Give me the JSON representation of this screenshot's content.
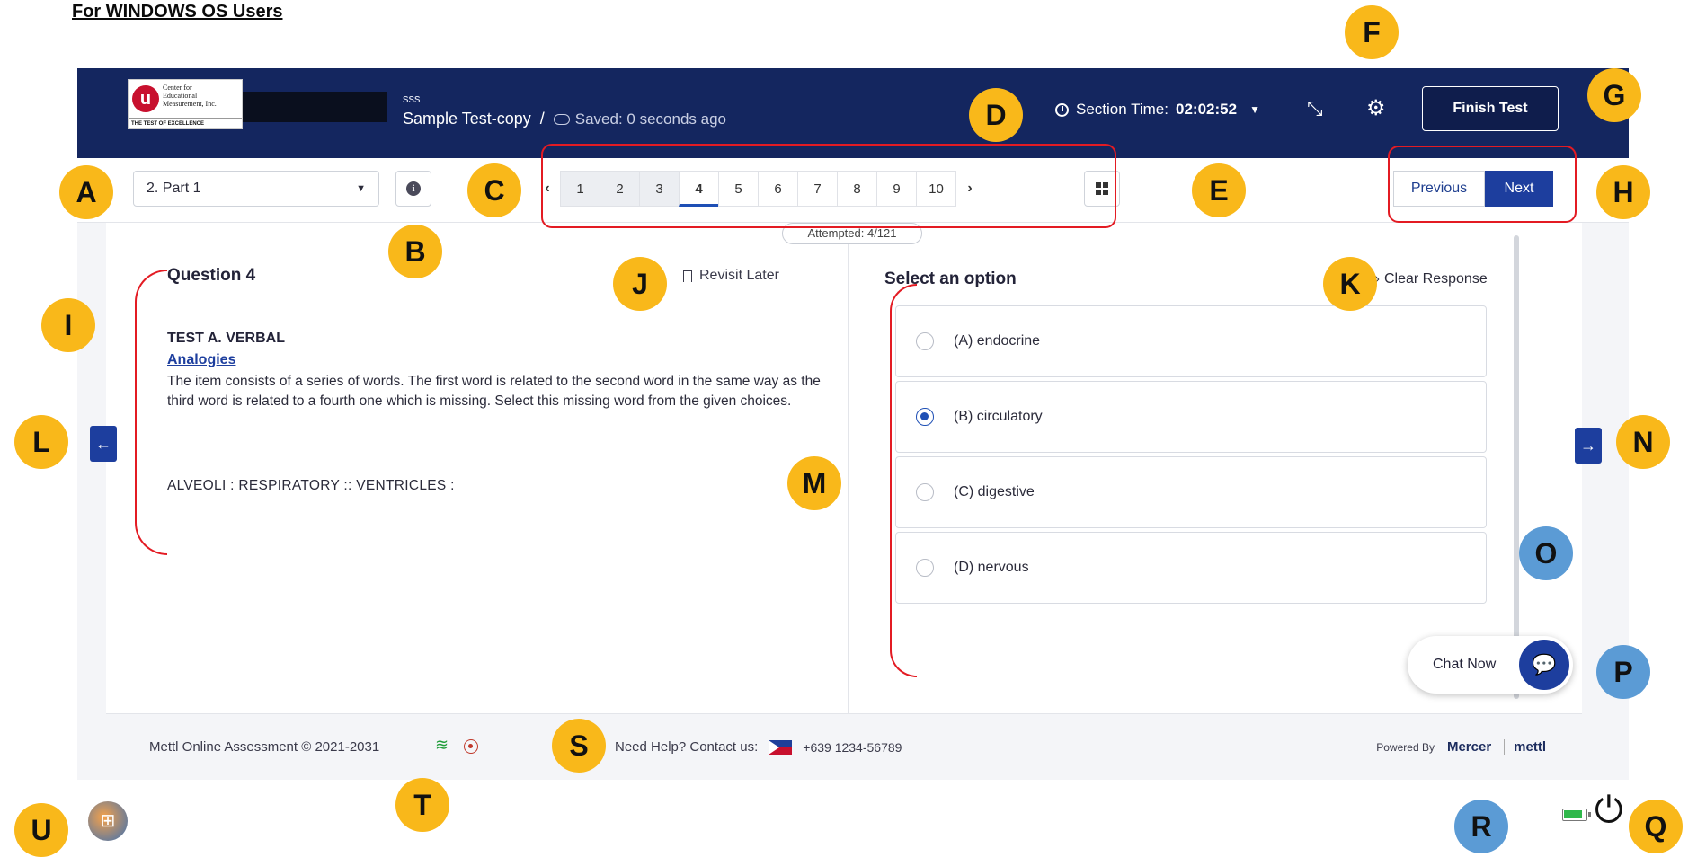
{
  "doc": {
    "heading": "For WINDOWS OS Users"
  },
  "header": {
    "logo_lines": [
      "Center for",
      "Educational",
      "Measurement, Inc."
    ],
    "logo_tagline": "THE TEST OF EXCELLENCE",
    "logo_letter": "u",
    "crumb_top": "sss",
    "test_name": "Sample Test-copy",
    "separator": "/",
    "saved_status": "Saved: 0 seconds ago",
    "section_time_label": "Section Time:",
    "section_time_value": "02:02:52",
    "finish_label": "Finish Test"
  },
  "toolbar": {
    "section_value": "2. Part 1",
    "question_numbers": [
      "1",
      "2",
      "3",
      "4",
      "5",
      "6",
      "7",
      "8",
      "9",
      "10"
    ],
    "current_question": "4",
    "prev_label": "Previous",
    "next_label": "Next",
    "attempted": "Attempted: 4/121"
  },
  "question": {
    "title": "Question 4",
    "revisit_label": "Revisit Later",
    "test_label": "TEST A. VERBAL",
    "sub_label": "Analogies",
    "body": "The item consists of a series of words. The first word is related to the second word in the same way as the third word is related to a fourth one which is missing.  Select this missing word from the given choices.",
    "prompt": "ALVEOLI : RESPIRATORY :: VENTRICLES :"
  },
  "options": {
    "title": "Select an option",
    "clear_label": "Clear Response",
    "items": [
      {
        "label": "(A)  endocrine",
        "selected": false
      },
      {
        "label": "(B)  circulatory",
        "selected": true
      },
      {
        "label": "(C)  digestive",
        "selected": false
      },
      {
        "label": "(D)  nervous",
        "selected": false
      }
    ]
  },
  "chat": {
    "label": "Chat Now"
  },
  "footer": {
    "copyright": "Mettl Online Assessment © 2021-2031",
    "help_label": "Need Help? Contact us:",
    "phone": "+639 1234-56789",
    "powered_by": "Powered By",
    "mercer": "Mercer",
    "mettl": "mettl"
  },
  "annotations": [
    "A",
    "B",
    "C",
    "D",
    "E",
    "F",
    "G",
    "H",
    "I",
    "J",
    "K",
    "L",
    "M",
    "N",
    "O",
    "P",
    "Q",
    "R",
    "S",
    "T",
    "U"
  ],
  "colors": {
    "header_bg": "#14265f",
    "accent": "#1d3e9e",
    "callout": "#f9b81a",
    "callout_alt": "#5b9bd5",
    "highlight": "#e31b23"
  }
}
